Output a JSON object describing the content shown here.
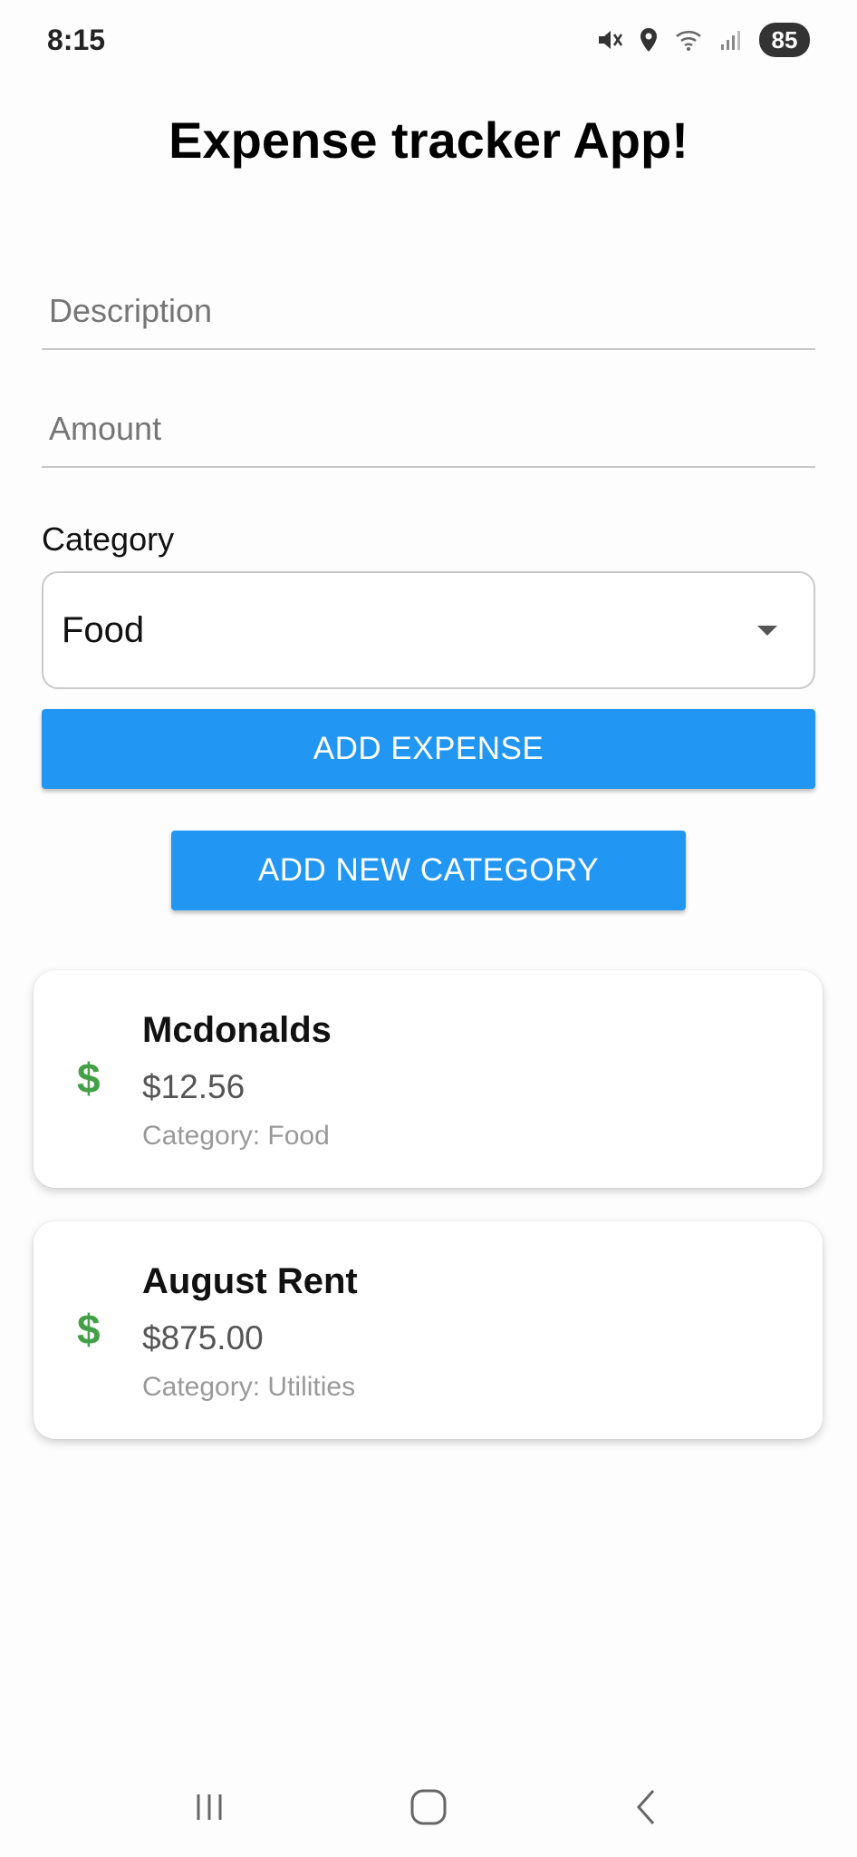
{
  "status_bar": {
    "time": "8:15",
    "battery": "85",
    "icons": [
      "mute-icon",
      "location-icon",
      "wifi-icon",
      "signal-icon"
    ]
  },
  "app": {
    "title": "Expense tracker App!"
  },
  "form": {
    "description_placeholder": "Description",
    "amount_placeholder": "Amount",
    "category_label": "Category",
    "category_selected": "Food",
    "add_expense_label": "ADD EXPENSE",
    "add_category_label": "ADD NEW CATEGORY"
  },
  "expenses": [
    {
      "icon": "dollar-icon",
      "icon_glyph": "$",
      "title": "Mcdonalds",
      "amount": "$12.56",
      "category": "Category: Food"
    },
    {
      "icon": "dollar-icon",
      "icon_glyph": "$",
      "title": "August Rent",
      "amount": "$875.00",
      "category": "Category: Utilities"
    }
  ],
  "colors": {
    "primary": "#2196f3",
    "dollar": "#43a047"
  },
  "nav": {
    "buttons": [
      "recent-apps-icon",
      "home-icon",
      "back-icon"
    ]
  }
}
